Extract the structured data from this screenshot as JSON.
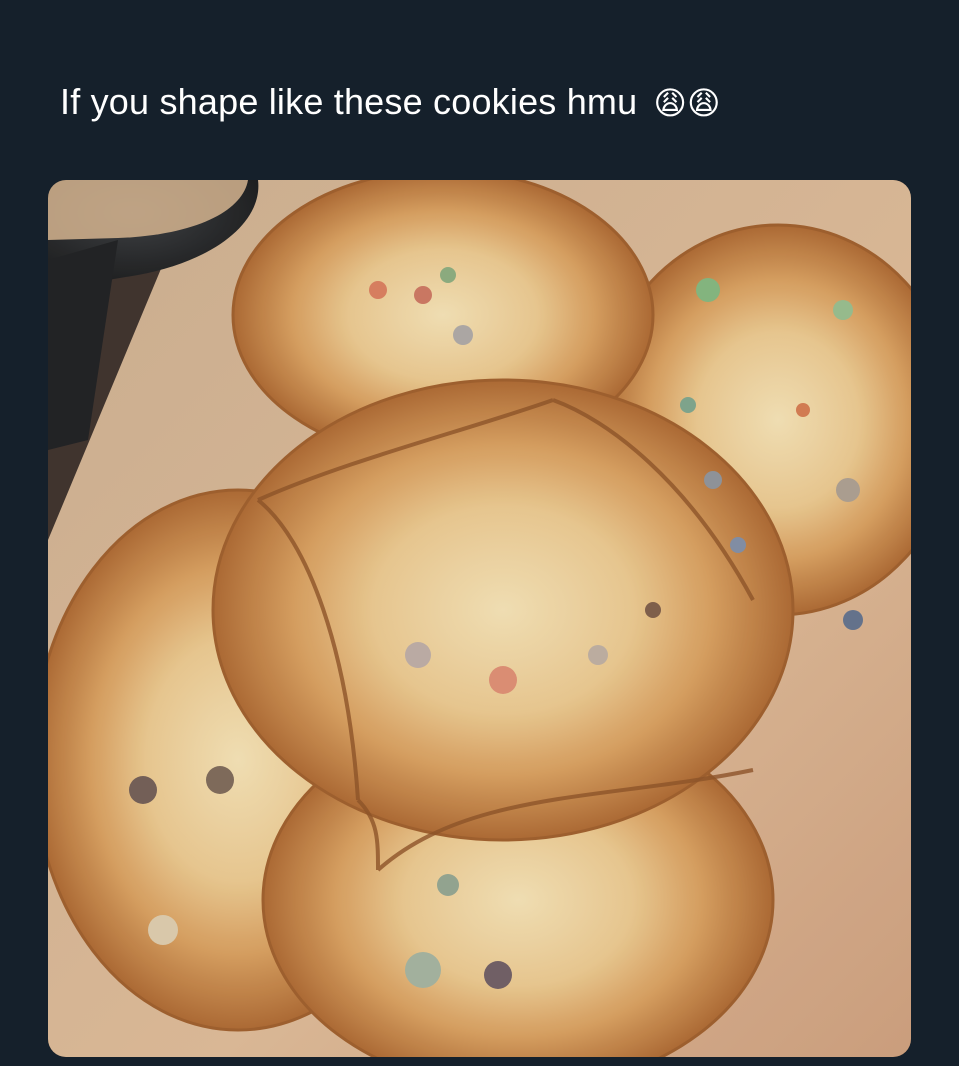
{
  "tweet": {
    "text": "If you shape like these cookies hmu",
    "emoji": "😩😩"
  },
  "media": {
    "alt": "Photo of six large baked cookies that have spread and merged together on parchment paper",
    "colors": {
      "background": "#15202b",
      "parchment": "#d9b48f",
      "cookie_edge": "#b06c34",
      "cookie_center": "#efd6a6"
    }
  }
}
